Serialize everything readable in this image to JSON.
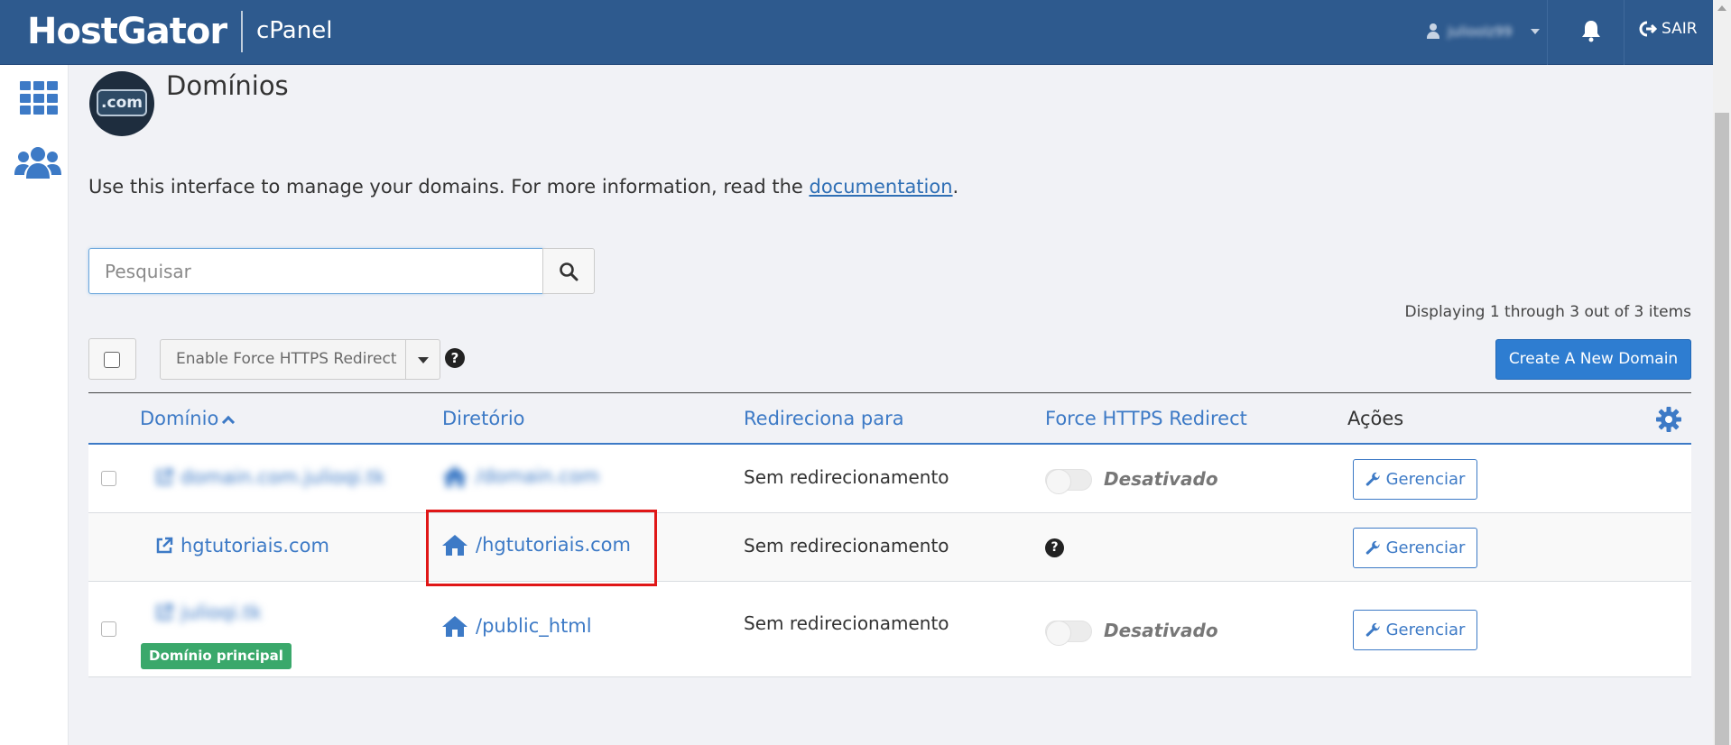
{
  "header": {
    "brand": "HostGator",
    "product": "cPanel",
    "user_name": "julioolz99",
    "logout_label": "SAIR"
  },
  "page": {
    "icon_label": ".com",
    "title": "Domínios",
    "intro_text": "Use this interface to manage your domains. For more information, read the ",
    "intro_link": "documentation",
    "intro_end": "."
  },
  "search": {
    "placeholder": "Pesquisar"
  },
  "pagination": {
    "summary": "Displaying 1 through 3 out of 3 items"
  },
  "toolbar": {
    "bulk_action_label": "Enable Force HTTPS Redirect",
    "create_label": "Create A New Domain"
  },
  "table": {
    "columns": {
      "domain": "Domínio",
      "directory": "Diretório",
      "redirect": "Redireciona para",
      "force_https": "Force HTTPS Redirect",
      "actions": "Ações"
    },
    "rows": [
      {
        "domain": "domain.com.julioqi.tk",
        "directory": "/domain.com",
        "redirect": "Sem redirecionamento",
        "force_https": "Desativado",
        "action": "Gerenciar"
      },
      {
        "domain": "hgtutoriais.com",
        "directory": "/hgtutoriais.com",
        "redirect": "Sem redirecionamento",
        "force_https": "",
        "action": "Gerenciar"
      },
      {
        "domain": "julioqi.tk",
        "badge": "Domínio principal",
        "directory": "/public_html",
        "redirect": "Sem redirecionamento",
        "force_https": "Desativado",
        "action": "Gerenciar"
      }
    ]
  },
  "colors": {
    "header_bg": "#2e5a8e",
    "link_blue": "#3d7ac6",
    "primary_button": "#2e7dd1",
    "badge_green": "#3aa86b",
    "highlight_red": "#e01717"
  }
}
